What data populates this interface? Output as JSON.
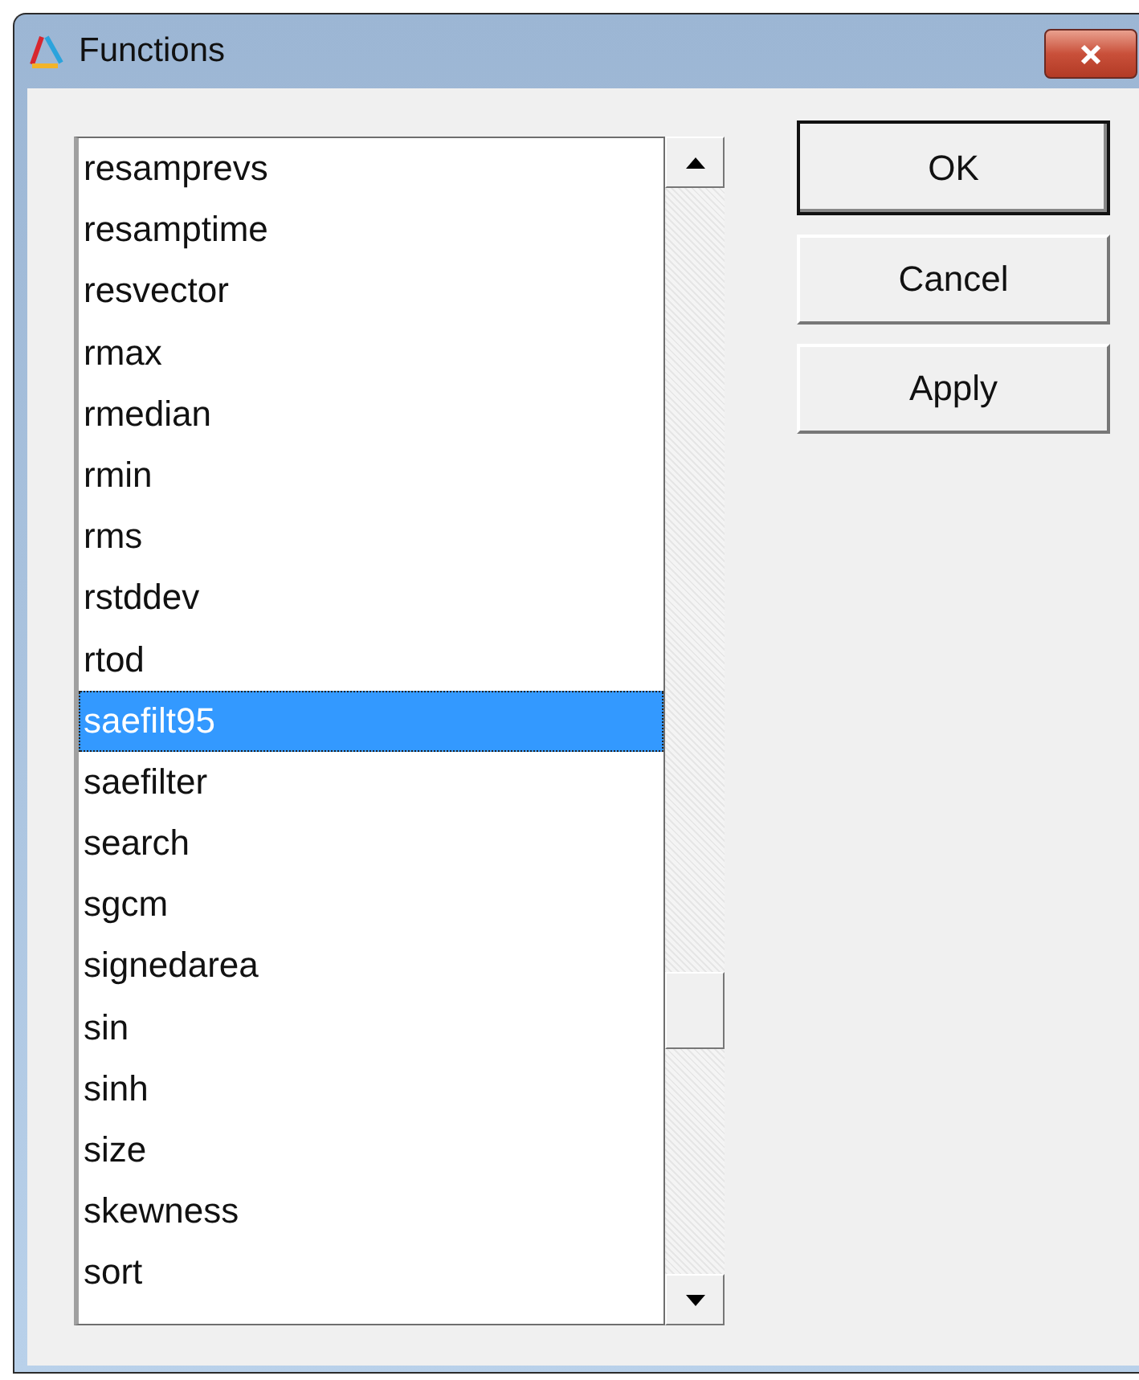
{
  "window": {
    "title": "Functions"
  },
  "list": {
    "items": [
      {
        "label": "resamprevs",
        "selected": false
      },
      {
        "label": "resamptime",
        "selected": false
      },
      {
        "label": "resvector",
        "selected": false
      },
      {
        "label": "rmax",
        "selected": false
      },
      {
        "label": "rmedian",
        "selected": false
      },
      {
        "label": "rmin",
        "selected": false
      },
      {
        "label": "rms",
        "selected": false
      },
      {
        "label": "rstddev",
        "selected": false
      },
      {
        "label": "rtod",
        "selected": false
      },
      {
        "label": "saefilt95",
        "selected": true
      },
      {
        "label": "saefilter",
        "selected": false
      },
      {
        "label": "search",
        "selected": false
      },
      {
        "label": "sgcm",
        "selected": false
      },
      {
        "label": "signedarea",
        "selected": false
      },
      {
        "label": "sin",
        "selected": false
      },
      {
        "label": "sinh",
        "selected": false
      },
      {
        "label": "size",
        "selected": false
      },
      {
        "label": "skewness",
        "selected": false
      },
      {
        "label": "sort",
        "selected": false
      }
    ]
  },
  "buttons": [
    {
      "label": "OK",
      "default": true
    },
    {
      "label": "Cancel",
      "default": false
    },
    {
      "label": "Apply",
      "default": false
    }
  ]
}
